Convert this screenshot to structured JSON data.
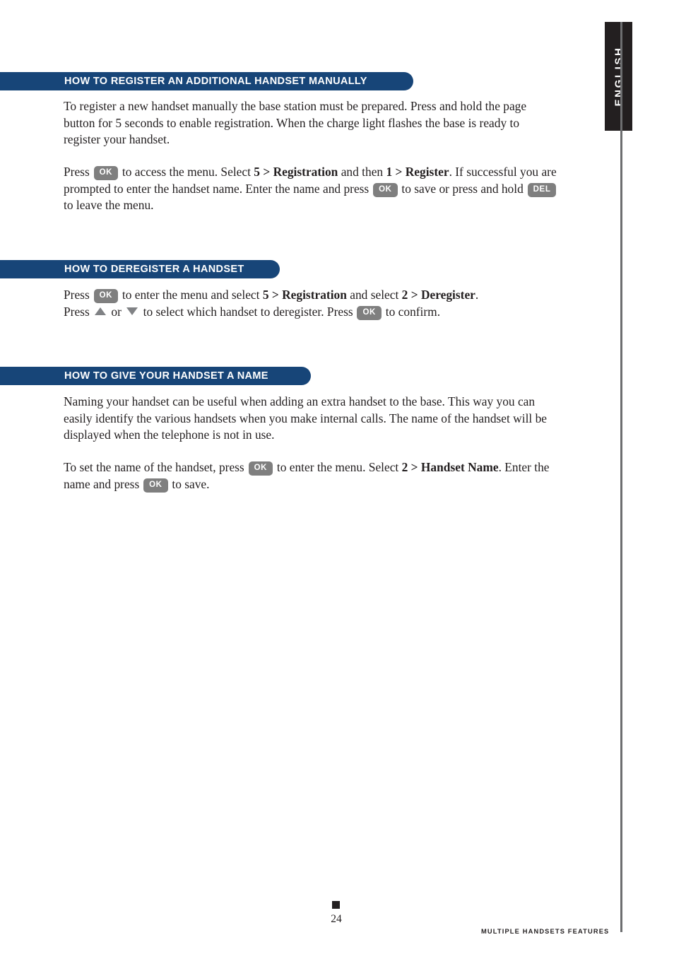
{
  "page": {
    "language_tab": "ENGLISH",
    "page_number": "24",
    "footer_section": "MULTIPLE HANDSETS FEATURES",
    "accent_color": "#174578",
    "key_color": "#7f7f7f",
    "tab_color": "#231f20",
    "rule_color": "#6d6e70"
  },
  "sections": [
    {
      "heading": "HOW TO REGISTER AN ADDITIONAL HANDSET MANUALLY",
      "paragraphs": [
        {
          "id": "register-p1",
          "runs": [
            {
              "type": "text",
              "text": "To register a new handset manually the base station must be prepared. Press and hold the page button for 5 seconds to enable registration. When the charge light flashes the base is ready to register your handset."
            }
          ]
        },
        {
          "id": "register-p2",
          "runs": [
            {
              "type": "text",
              "text": "Press "
            },
            {
              "type": "key",
              "text": "OK"
            },
            {
              "type": "text",
              "text": " to access the menu. Select "
            },
            {
              "type": "bold",
              "text": "5 > Registration"
            },
            {
              "type": "text",
              "text": " and then "
            },
            {
              "type": "bold",
              "text": "1 > Register"
            },
            {
              "type": "text",
              "text": ". If successful you are prompted to enter the handset name. Enter the name and press "
            },
            {
              "type": "key",
              "text": "OK"
            },
            {
              "type": "text",
              "text": " to save or press and hold "
            },
            {
              "type": "key",
              "text": "DEL"
            },
            {
              "type": "text",
              "text": " to leave the menu."
            }
          ]
        }
      ]
    },
    {
      "heading": "HOW TO DEREGISTER A HANDSET",
      "paragraphs": [
        {
          "id": "deregister-p1",
          "runs": [
            {
              "type": "text",
              "text": "Press "
            },
            {
              "type": "key",
              "text": "OK"
            },
            {
              "type": "text",
              "text": " to enter the menu and select "
            },
            {
              "type": "bold",
              "text": "5 > Registration"
            },
            {
              "type": "text",
              "text": " and select "
            },
            {
              "type": "bold",
              "text": "2 > Deregister"
            },
            {
              "type": "text",
              "text": "."
            },
            {
              "type": "break"
            },
            {
              "type": "text",
              "text": "Press "
            },
            {
              "type": "arrow-up",
              "text": "up-arrow"
            },
            {
              "type": "text",
              "text": " or "
            },
            {
              "type": "arrow-down",
              "text": "down-arrow"
            },
            {
              "type": "text",
              "text": " to select which handset to deregister. Press "
            },
            {
              "type": "key",
              "text": "OK"
            },
            {
              "type": "text",
              "text": " to confirm."
            }
          ]
        }
      ]
    },
    {
      "heading": "HOW TO GIVE YOUR HANDSET A NAME",
      "paragraphs": [
        {
          "id": "name-p1",
          "runs": [
            {
              "type": "text",
              "text": "Naming your handset can be useful when adding an extra handset to the base. This way you can easily identify the various handsets when you make internal calls. The name of the handset will be displayed when the telephone is not in use."
            }
          ]
        },
        {
          "id": "name-p2",
          "runs": [
            {
              "type": "text",
              "text": "To set the name of the handset, press "
            },
            {
              "type": "key",
              "text": "OK"
            },
            {
              "type": "text",
              "text": " to enter the menu. Select "
            },
            {
              "type": "bold",
              "text": "2 > Handset Name"
            },
            {
              "type": "text",
              "text": ". Enter the name and press "
            },
            {
              "type": "key",
              "text": "OK"
            },
            {
              "type": "text",
              "text": " to save."
            }
          ]
        }
      ]
    }
  ]
}
